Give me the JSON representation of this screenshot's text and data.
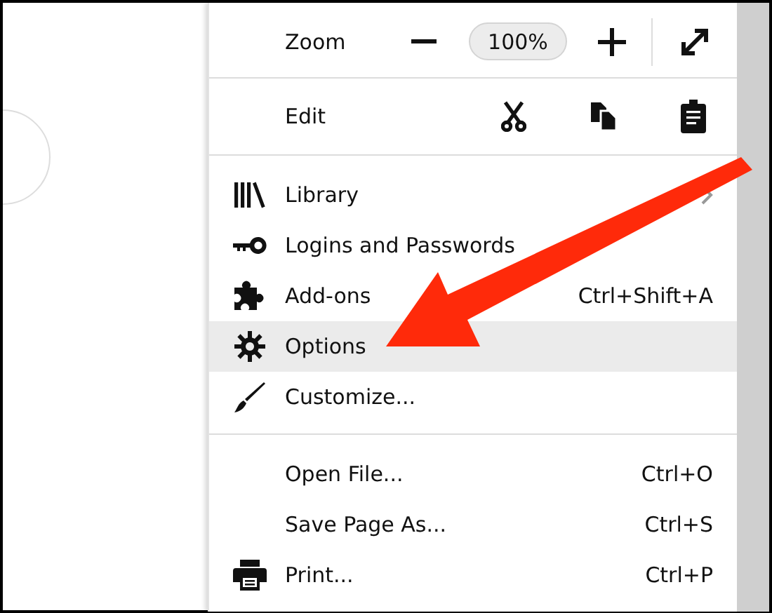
{
  "zoom": {
    "label": "Zoom",
    "value": "100%"
  },
  "edit": {
    "label": "Edit"
  },
  "menu_groups": [
    [
      {
        "label": "Library",
        "submenu": true,
        "selected": false
      },
      {
        "label": "Logins and Passwords",
        "submenu": false,
        "selected": false
      },
      {
        "label": "Add-ons",
        "shortcut": "Ctrl+Shift+A",
        "submenu": false,
        "selected": false
      },
      {
        "label": "Options",
        "submenu": false,
        "selected": true
      },
      {
        "label": "Customize...",
        "submenu": false,
        "selected": false
      }
    ],
    [
      {
        "label": "Open File...",
        "shortcut": "Ctrl+O",
        "submenu": false,
        "selected": false
      },
      {
        "label": "Save Page As...",
        "shortcut": "Ctrl+S",
        "submenu": false,
        "selected": false
      },
      {
        "label": "Print...",
        "shortcut": "Ctrl+P",
        "submenu": false,
        "selected": false
      }
    ]
  ]
}
